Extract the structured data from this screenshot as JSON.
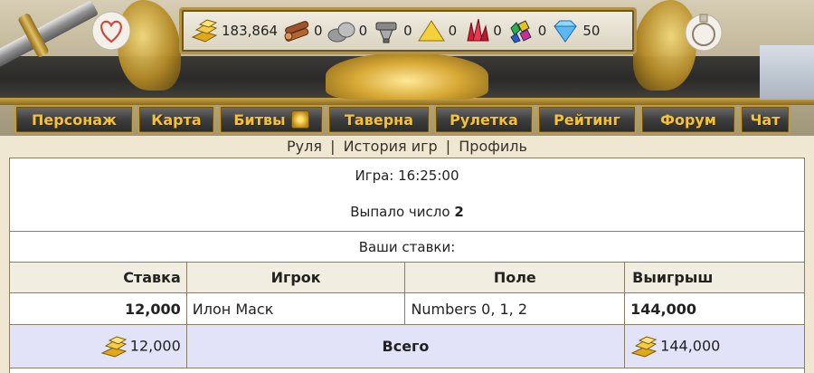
{
  "resources": [
    {
      "icon": "gold-bars-icon",
      "value": "183,864"
    },
    {
      "icon": "wood-logs-icon",
      "value": "0"
    },
    {
      "icon": "stone-icon",
      "value": "0"
    },
    {
      "icon": "iron-ore-icon",
      "value": "0"
    },
    {
      "icon": "sulfur-icon",
      "value": "0"
    },
    {
      "icon": "crystals-icon",
      "value": "0"
    },
    {
      "icon": "gems-icon",
      "value": "0"
    },
    {
      "icon": "diamond-icon",
      "value": "50"
    }
  ],
  "nav": {
    "items": [
      "Персонаж",
      "Карта",
      "Битвы",
      "Таверна",
      "Рулетка",
      "Рейтинг",
      "Форум",
      "Чат"
    ]
  },
  "sublinks": {
    "roulette": "Руля",
    "history": "История игр",
    "profile": "Профиль",
    "separator": "|"
  },
  "game": {
    "time_label": "Игра: 16:25:00",
    "result_label": "Выпало число",
    "result_number": "2",
    "bets_caption": "Ваши ставки:"
  },
  "table": {
    "headers": {
      "bet": "Ставка",
      "player": "Игрок",
      "field": "Поле",
      "win": "Выигрыш"
    },
    "rows": [
      {
        "bet": "12,000",
        "player": "Илон Маск",
        "field": "Numbers 0, 1, 2",
        "win": "144,000"
      }
    ],
    "total": {
      "bet": "12,000",
      "label": "Всего",
      "win": "144,000"
    }
  },
  "colors": {
    "nav_text": "#f2c23a",
    "total_row_bg": "#e2e2f8",
    "header_row_bg": "#f2ede1"
  }
}
